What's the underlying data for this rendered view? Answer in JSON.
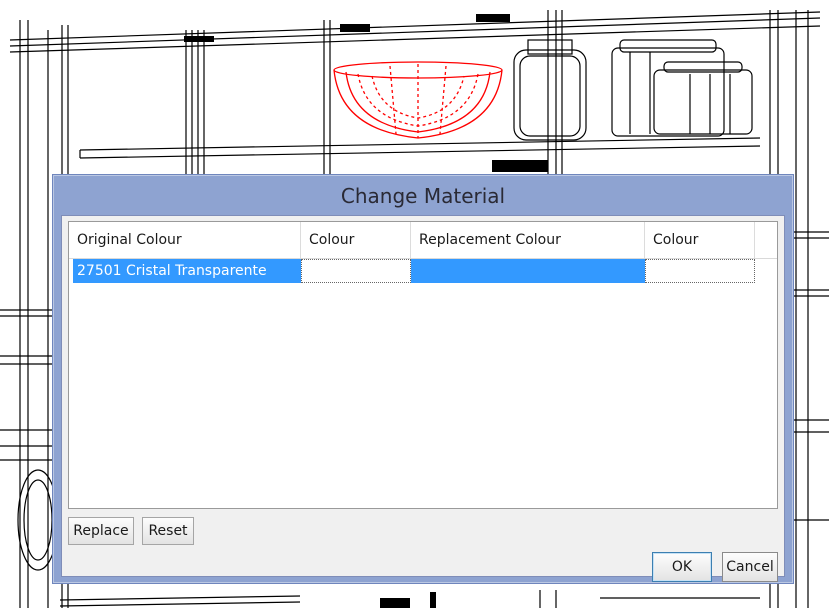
{
  "dialog": {
    "title": "Change Material",
    "columns": [
      "Original Colour",
      "Colour",
      "Replacement Colour",
      "Colour"
    ],
    "rows": [
      {
        "original_colour": "27501 Cristal Transparente",
        "colour_swatch": "#ffffff",
        "replacement_colour": "",
        "replacement_swatch": "#3399ff",
        "replacement_colour_swatch": "#ffffff"
      }
    ],
    "buttons": {
      "replace": "Replace",
      "reset": "Reset",
      "ok": "OK",
      "cancel": "Cancel"
    }
  },
  "colors": {
    "selection": "#3399ff",
    "dialog_frame": "#8ea3d1",
    "highlighted_object": "#ff0000",
    "wireframe": "#000000"
  },
  "background": {
    "scene": "3D wireframe view of shelving with jars and a red highlighted bowl",
    "highlighted_object_icon": "bowl-icon"
  }
}
